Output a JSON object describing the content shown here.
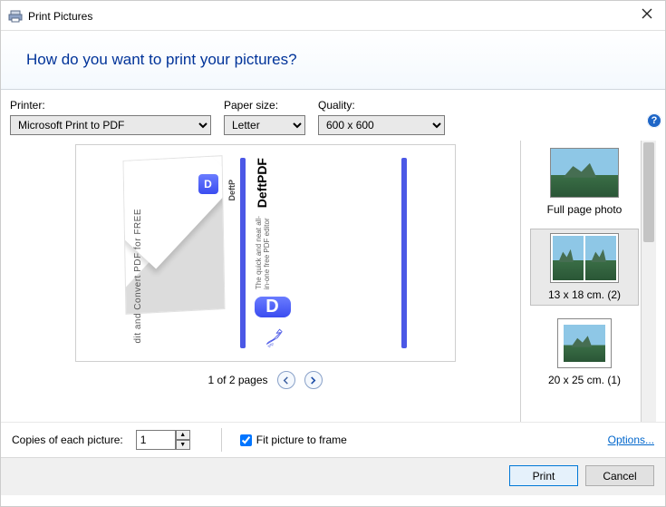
{
  "window": {
    "title": "Print Pictures",
    "heading": "How do you want to print your pictures?"
  },
  "controls": {
    "printer_label": "Printer:",
    "printer_value": "Microsoft Print to PDF",
    "paper_label": "Paper size:",
    "paper_value": "Letter",
    "quality_label": "Quality:",
    "quality_value": "600 x 600"
  },
  "preview": {
    "pager_text": "1 of 2 pages",
    "doc_brand": "DeftPDF",
    "doc_tagline": "The quick and neat all-in-one\nfree PDF editor",
    "doc_side_text": "dit and Convert PDF for FREE",
    "doc_side_small": "DeftP"
  },
  "layouts": [
    {
      "label": "Full page photo"
    },
    {
      "label": "13 x 18 cm. (2)"
    },
    {
      "label": "20 x 25 cm. (1)"
    }
  ],
  "bottom": {
    "copies_label": "Copies of each picture:",
    "copies_value": "1",
    "fit_label": "Fit picture to frame",
    "options_link": "Options...",
    "print_button": "Print",
    "cancel_button": "Cancel"
  }
}
